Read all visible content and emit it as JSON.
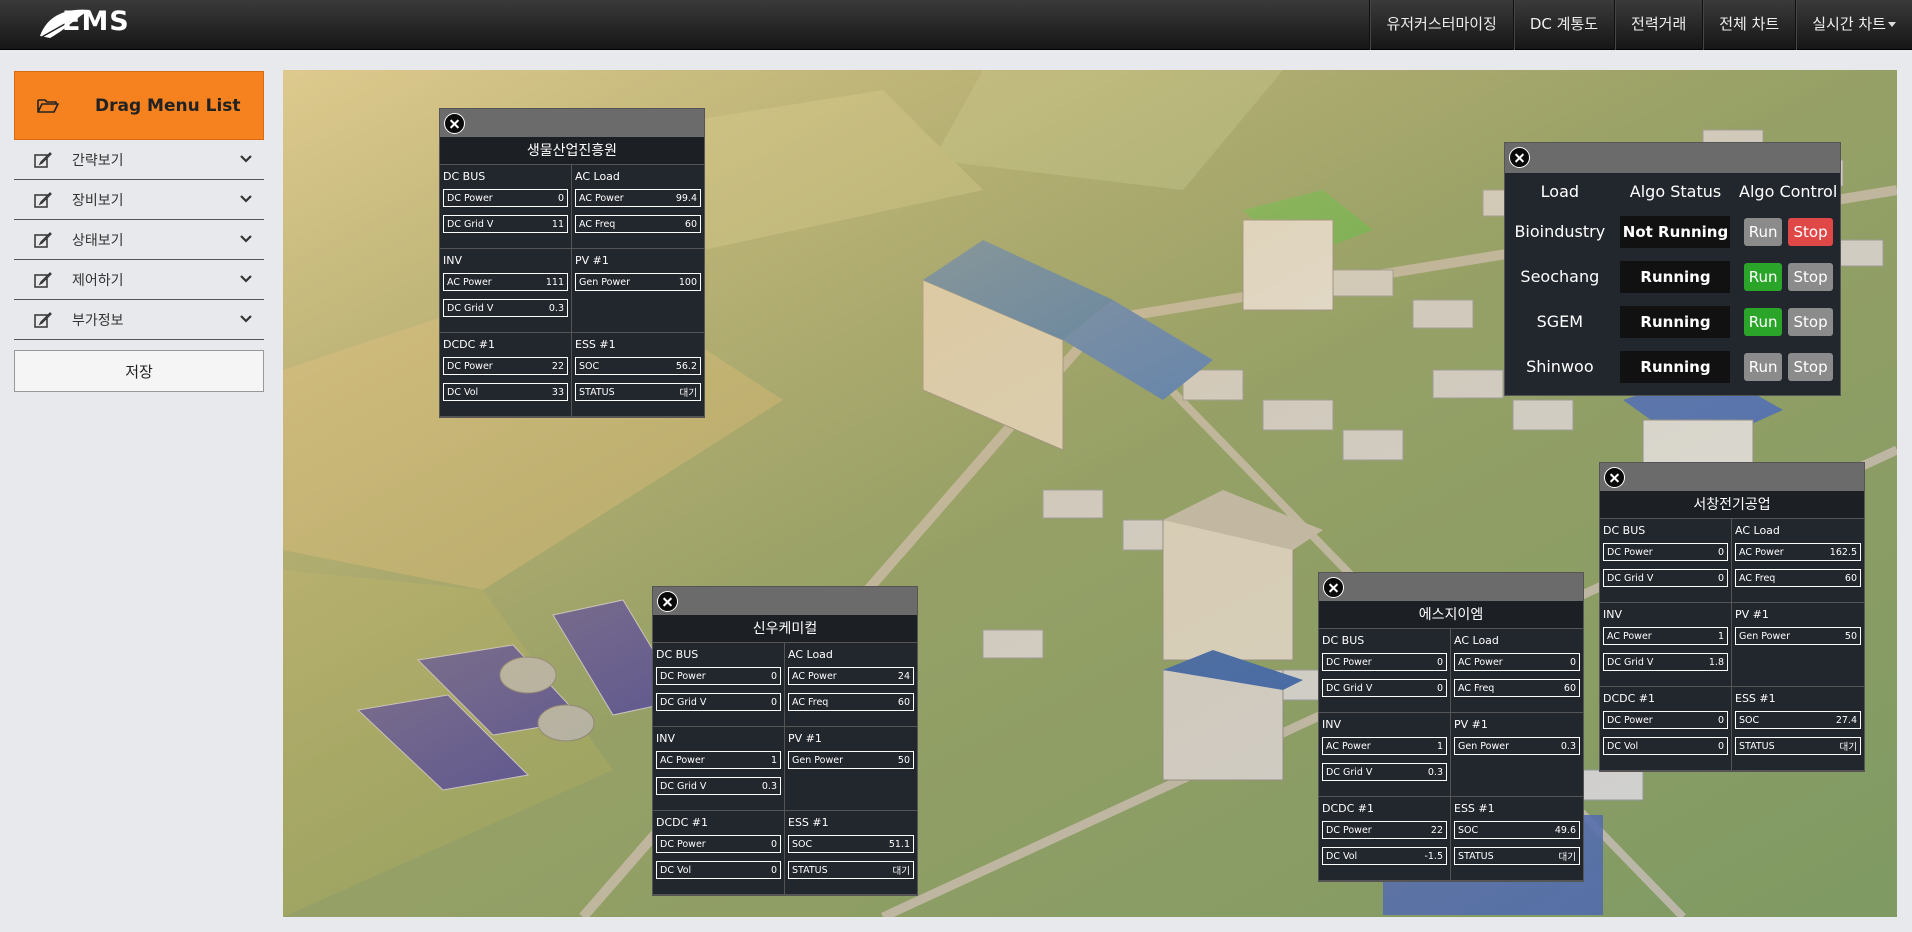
{
  "brand": {
    "logo_text": "EMS"
  },
  "nav": {
    "items": [
      "유저커스터마이징",
      "DC 계통도",
      "전력거래",
      "전체 차트",
      "실시간 차트"
    ]
  },
  "sidebar": {
    "header": "Drag Menu List",
    "items": [
      {
        "label": "간략보기"
      },
      {
        "label": "장비보기"
      },
      {
        "label": "상태보기"
      },
      {
        "label": "제어하기"
      },
      {
        "label": "부가정보"
      }
    ],
    "save_label": "저장"
  },
  "algo": {
    "headers": {
      "load": "Load",
      "status": "Algo Status",
      "control": "Algo Control"
    },
    "run_label": "Run",
    "stop_label": "Stop",
    "rows": [
      {
        "load": "Bioindustry",
        "status": "Not Running",
        "run_active": false,
        "stop_active": true
      },
      {
        "load": "Seochang",
        "status": "Running",
        "run_active": true,
        "stop_active": false
      },
      {
        "load": "SGEM",
        "status": "Running",
        "run_active": true,
        "stop_active": false
      },
      {
        "load": "Shinwoo",
        "status": "Running",
        "run_active": false,
        "stop_active": false
      }
    ]
  },
  "labels": {
    "dc_bus": "DC BUS",
    "ac_load": "AC Load",
    "inv": "INV",
    "pv": "PV #1",
    "dcdc": "DCDC #1",
    "ess": "ESS #1",
    "dc_power": "DC Power",
    "dc_grid_v": "DC Grid V",
    "ac_power": "AC Power",
    "ac_freq": "AC Freq",
    "gen_power": "Gen Power",
    "dc_vol": "DC Vol",
    "soc": "SOC",
    "status": "STATUS"
  },
  "sites": [
    {
      "name": "생물산업진흥원",
      "dc_bus": {
        "dc_power": "0",
        "dc_grid_v": "11"
      },
      "ac_load": {
        "ac_power": "99.4",
        "ac_freq": "60"
      },
      "inv": {
        "ac_power": "111",
        "dc_grid_v": "0.3"
      },
      "pv": {
        "gen_power": "100"
      },
      "dcdc": {
        "dc_power": "22",
        "dc_vol": "33"
      },
      "ess": {
        "soc": "56.2",
        "status": "대기"
      }
    },
    {
      "name": "신우케미컬",
      "dc_bus": {
        "dc_power": "0",
        "dc_grid_v": "0"
      },
      "ac_load": {
        "ac_power": "24",
        "ac_freq": "60"
      },
      "inv": {
        "ac_power": "1",
        "dc_grid_v": "0.3"
      },
      "pv": {
        "gen_power": "50"
      },
      "dcdc": {
        "dc_power": "0",
        "dc_vol": "0"
      },
      "ess": {
        "soc": "51.1",
        "status": "대기"
      }
    },
    {
      "name": "에스지이엠",
      "dc_bus": {
        "dc_power": "0",
        "dc_grid_v": "0"
      },
      "ac_load": {
        "ac_power": "0",
        "ac_freq": "60"
      },
      "inv": {
        "ac_power": "1",
        "dc_grid_v": "0.3"
      },
      "pv": {
        "gen_power": "0.3"
      },
      "dcdc": {
        "dc_power": "22",
        "dc_vol": "-1.5"
      },
      "ess": {
        "soc": "49.6",
        "status": "대기"
      }
    },
    {
      "name": "서창전기공업",
      "dc_bus": {
        "dc_power": "0",
        "dc_grid_v": "0"
      },
      "ac_load": {
        "ac_power": "162.5",
        "ac_freq": "60"
      },
      "inv": {
        "ac_power": "1",
        "dc_grid_v": "1.8"
      },
      "pv": {
        "gen_power": "50"
      },
      "dcdc": {
        "dc_power": "0",
        "dc_vol": "0"
      },
      "ess": {
        "soc": "27.4",
        "status": "대기"
      }
    }
  ],
  "colors": {
    "accent": "#f5811f",
    "run": "#2aa52a",
    "stop": "#e04848",
    "panel": "#22262d"
  }
}
